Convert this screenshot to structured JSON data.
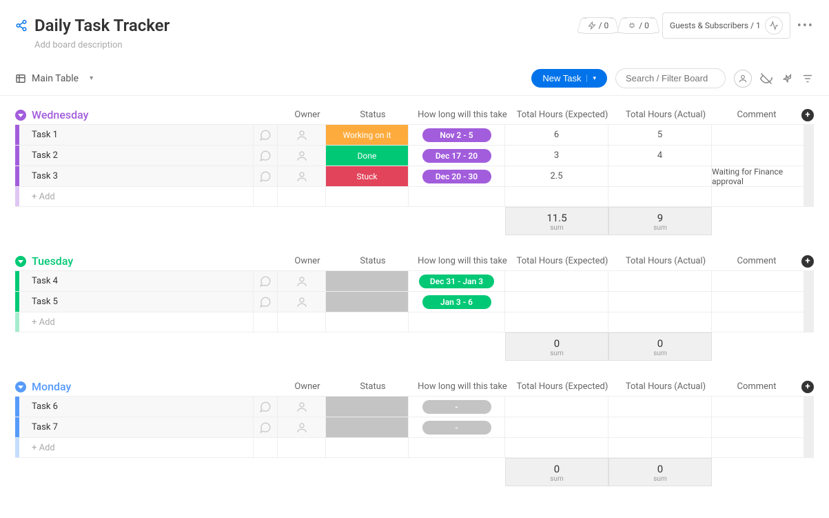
{
  "header": {
    "title": "Daily Task Tracker",
    "description_placeholder": "Add board description",
    "bolt_count": "/ 0",
    "robot_count": "/ 0",
    "guests_label": "Guests & Subscribers / 1"
  },
  "toolbar": {
    "view_label": "Main Table",
    "new_task_label": "New Task",
    "search_placeholder": "Search / Filter Board"
  },
  "columns": {
    "owner": "Owner",
    "status": "Status",
    "how": "How long will this take",
    "expected": "Total Hours (Expected)",
    "actual": "Total Hours (Actual)",
    "comment": "Comment"
  },
  "add_row_label": "+ Add",
  "sum_label": "sum",
  "groups": [
    {
      "name": "Wednesday",
      "color": "#a25ddc",
      "pill_color": "#a25ddc",
      "rows": [
        {
          "name": "Task 1",
          "status_label": "Working on it",
          "status_color": "#fdab3d",
          "how": "Nov 2 - 5",
          "expected": "6",
          "actual": "5",
          "comment": ""
        },
        {
          "name": "Task 2",
          "status_label": "Done",
          "status_color": "#00c875",
          "how": "Dec 17 - 20",
          "expected": "3",
          "actual": "4",
          "comment": ""
        },
        {
          "name": "Task 3",
          "status_label": "Stuck",
          "status_color": "#e2445c",
          "how": "Dec 20 - 30",
          "expected": "2.5",
          "actual": "",
          "comment": "Waiting for Finance approval"
        }
      ],
      "sum_expected": "11.5",
      "sum_actual": "9"
    },
    {
      "name": "Tuesday",
      "color": "#00c875",
      "pill_color": "#00c875",
      "rows": [
        {
          "name": "Task 4",
          "status_label": "",
          "status_color": "#c4c4c4",
          "how": "Dec 31 - Jan 3",
          "expected": "",
          "actual": "",
          "comment": ""
        },
        {
          "name": "Task 5",
          "status_label": "",
          "status_color": "#c4c4c4",
          "how": "Jan 3 - 6",
          "expected": "",
          "actual": "",
          "comment": ""
        }
      ],
      "sum_expected": "0",
      "sum_actual": "0"
    },
    {
      "name": "Monday",
      "color": "#579bfc",
      "pill_color": "#c4c4c4",
      "rows": [
        {
          "name": "Task 6",
          "status_label": "",
          "status_color": "#c4c4c4",
          "how": "-",
          "expected": "",
          "actual": "",
          "comment": ""
        },
        {
          "name": "Task 7",
          "status_label": "",
          "status_color": "#c4c4c4",
          "how": "-",
          "expected": "",
          "actual": "",
          "comment": ""
        }
      ],
      "sum_expected": "0",
      "sum_actual": "0"
    }
  ]
}
